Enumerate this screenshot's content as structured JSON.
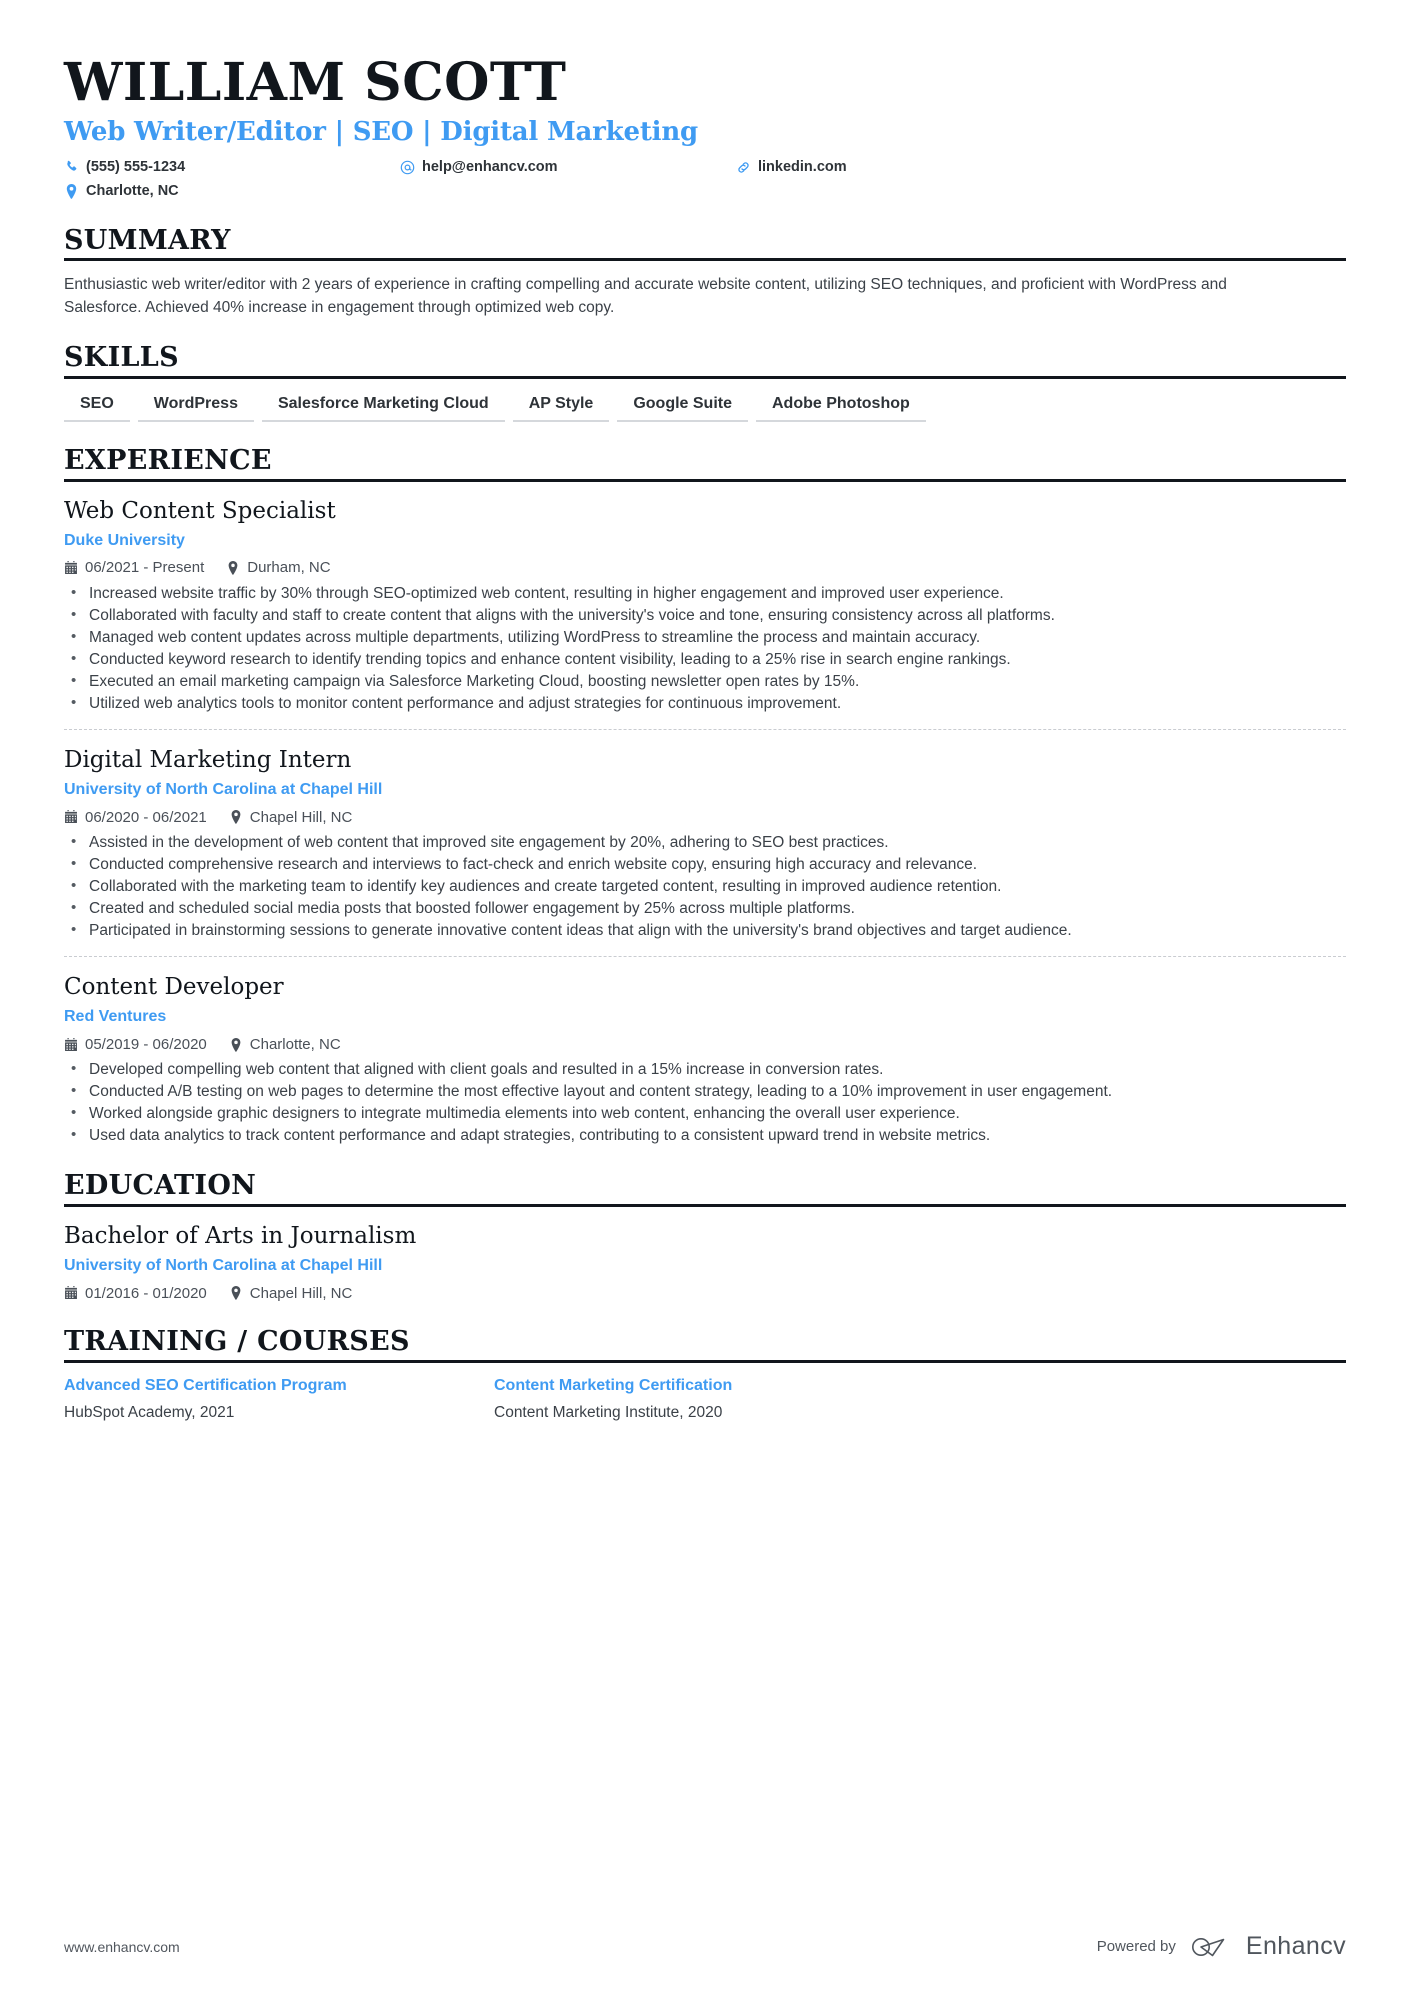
{
  "accent_color": "#3f9bf2",
  "text_color": "#2e3338",
  "rule_color": "#11161c",
  "header": {
    "name": "WILLIAM SCOTT",
    "headline": "Web Writer/Editor | SEO | Digital Marketing",
    "contacts": [
      {
        "icon": "phone-icon",
        "text": "(555) 555-1234"
      },
      {
        "icon": "email-icon",
        "text": "help@enhancv.com"
      },
      {
        "icon": "link-icon",
        "text": "linkedin.com"
      },
      {
        "icon": "location-icon",
        "text": "Charlotte, NC"
      }
    ]
  },
  "summary": {
    "title": "SUMMARY",
    "text": "Enthusiastic web writer/editor with 2 years of experience in crafting compelling and accurate website content, utilizing SEO techniques, and proficient with WordPress and Salesforce. Achieved 40% increase in engagement through optimized web copy."
  },
  "skills": {
    "title": "SKILLS",
    "items": [
      "SEO",
      "WordPress",
      "Salesforce Marketing Cloud",
      "AP Style",
      "Google Suite",
      "Adobe Photoshop"
    ]
  },
  "experience": {
    "title": "EXPERIENCE",
    "entries": [
      {
        "role": "Web Content Specialist",
        "org": "Duke University",
        "dates": "06/2021 - Present",
        "location": "Durham, NC",
        "bullets": [
          "Increased website traffic by 30% through SEO-optimized web content, resulting in higher engagement and improved user experience.",
          "Collaborated with faculty and staff to create content that aligns with the university's voice and tone, ensuring consistency across all platforms.",
          "Managed web content updates across multiple departments, utilizing WordPress to streamline the process and maintain accuracy.",
          "Conducted keyword research to identify trending topics and enhance content visibility, leading to a 25% rise in search engine rankings.",
          "Executed an email marketing campaign via Salesforce Marketing Cloud, boosting newsletter open rates by 15%.",
          "Utilized web analytics tools to monitor content performance and adjust strategies for continuous improvement."
        ]
      },
      {
        "role": "Digital Marketing Intern",
        "org": "University of North Carolina at Chapel Hill",
        "dates": "06/2020 - 06/2021",
        "location": "Chapel Hill, NC",
        "bullets": [
          "Assisted in the development of web content that improved site engagement by 20%, adhering to SEO best practices.",
          "Conducted comprehensive research and interviews to fact-check and enrich website copy, ensuring high accuracy and relevance.",
          "Collaborated with the marketing team to identify key audiences and create targeted content, resulting in improved audience retention.",
          "Created and scheduled social media posts that boosted follower engagement by 25% across multiple platforms.",
          "Participated in brainstorming sessions to generate innovative content ideas that align with the university's brand objectives and target audience."
        ]
      },
      {
        "role": "Content Developer",
        "org": "Red Ventures",
        "dates": "05/2019 - 06/2020",
        "location": "Charlotte, NC",
        "bullets": [
          "Developed compelling web content that aligned with client goals and resulted in a 15% increase in conversion rates.",
          "Conducted A/B testing on web pages to determine the most effective layout and content strategy, leading to a 10% improvement in user engagement.",
          "Worked alongside graphic designers to integrate multimedia elements into web content, enhancing the overall user experience.",
          "Used data analytics to track content performance and adapt strategies, contributing to a consistent upward trend in website metrics."
        ]
      }
    ]
  },
  "education": {
    "title": "EDUCATION",
    "entries": [
      {
        "degree": "Bachelor of Arts in Journalism",
        "org": "University of North Carolina at Chapel Hill",
        "dates": "01/2016 - 01/2020",
        "location": "Chapel Hill, NC"
      }
    ]
  },
  "training": {
    "title": "TRAINING / COURSES",
    "courses": [
      {
        "name": "Advanced SEO Certification Program",
        "provider": "HubSpot Academy, 2021"
      },
      {
        "name": "Content Marketing Certification",
        "provider": "Content Marketing Institute, 2020"
      }
    ]
  },
  "footer": {
    "url": "www.enhancv.com",
    "powered_by": "Powered by",
    "brand": "Enhancv"
  }
}
